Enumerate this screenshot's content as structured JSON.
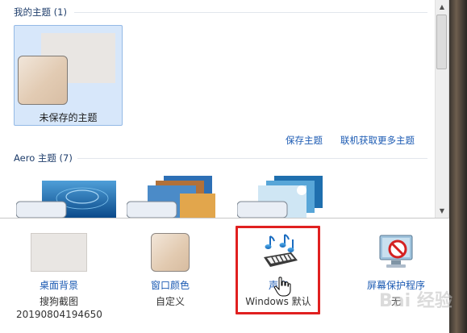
{
  "theme_panel": {
    "my_themes_header": "我的主题 (1)",
    "unsaved_theme_label": "未保存的主题",
    "save_theme_link": "保存主题",
    "get_more_themes_link": "联机获取更多主题",
    "aero_header": "Aero 主题 (7)"
  },
  "bottom": {
    "desktop_background": {
      "label": "桌面背景",
      "value_line1": "搜狗截图",
      "value_line2": "20190804194650"
    },
    "window_color": {
      "label": "窗口颜色",
      "value": "自定义"
    },
    "sounds": {
      "label": "声音",
      "value": "Windows 默认"
    },
    "screensaver": {
      "label": "屏幕保护程序",
      "value": "无"
    }
  },
  "watermark": "Bai 经验",
  "colors": {
    "link": "#1c5bb3",
    "highlight_box": "#e02020",
    "selected_tile": "#d7e7fa"
  }
}
